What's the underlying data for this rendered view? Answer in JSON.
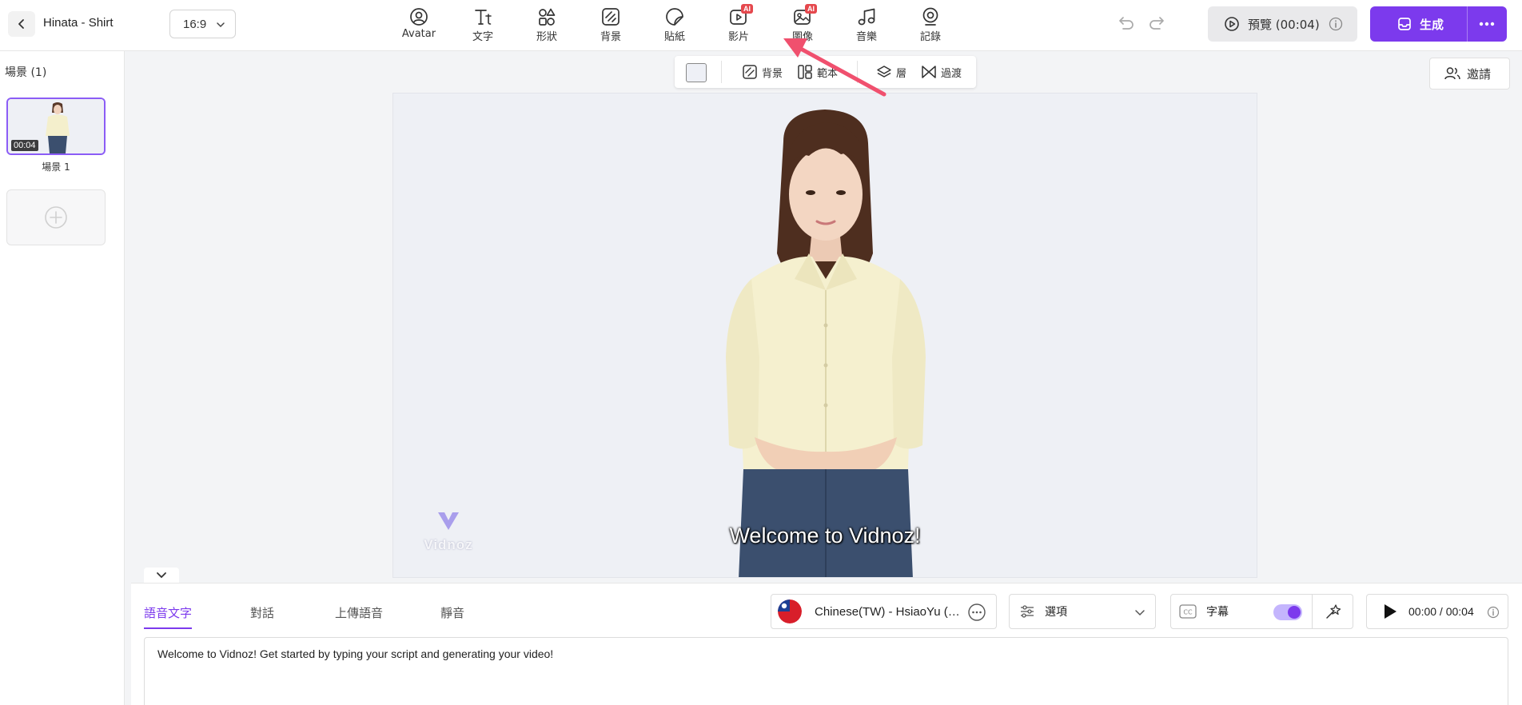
{
  "header": {
    "project_title": "Hinata - Shirt",
    "aspect_ratio": "16:9",
    "tools": [
      {
        "label": "Avatar",
        "icon": "avatar-icon"
      },
      {
        "label": "文字",
        "icon": "text-icon"
      },
      {
        "label": "形狀",
        "icon": "shapes-icon"
      },
      {
        "label": "背景",
        "icon": "background-icon"
      },
      {
        "label": "貼紙",
        "icon": "sticker-icon"
      },
      {
        "label": "影片",
        "icon": "video-icon",
        "badge": "AI"
      },
      {
        "label": "圖像",
        "icon": "image-icon",
        "badge": "AI"
      },
      {
        "label": "音樂",
        "icon": "music-icon"
      },
      {
        "label": "記錄",
        "icon": "record-icon"
      }
    ],
    "preview_label": "預覽 (00:04)",
    "generate_label": "生成"
  },
  "scenes": {
    "header": "場景 (1)",
    "items": [
      {
        "label": "場景 1",
        "duration": "00:04"
      }
    ]
  },
  "canvas_toolbar": {
    "background_label": "背景",
    "template_label": "範本",
    "layer_label": "層",
    "transition_label": "過渡"
  },
  "invite_label": "邀請",
  "stage": {
    "subtitle": "Welcome to Vidnoz!",
    "watermark": "Vidnoz"
  },
  "script_panel": {
    "tabs": [
      {
        "label": "語音文字",
        "active": true
      },
      {
        "label": "對話",
        "active": false
      },
      {
        "label": "上傳語音",
        "active": false
      },
      {
        "label": "靜音",
        "active": false
      }
    ],
    "voice": "Chinese(TW) - HsiaoYu (Taiwan)",
    "options_label": "選項",
    "caption_label": "字幕",
    "caption_enabled": true,
    "playback_time": "00:00 / 00:04",
    "script_text": "Welcome to Vidnoz! Get started by typing your script and generating your video!"
  },
  "colors": {
    "accent": "#7c3aed",
    "ai_badge": "#e5484d",
    "arrow": "#f0506e"
  }
}
